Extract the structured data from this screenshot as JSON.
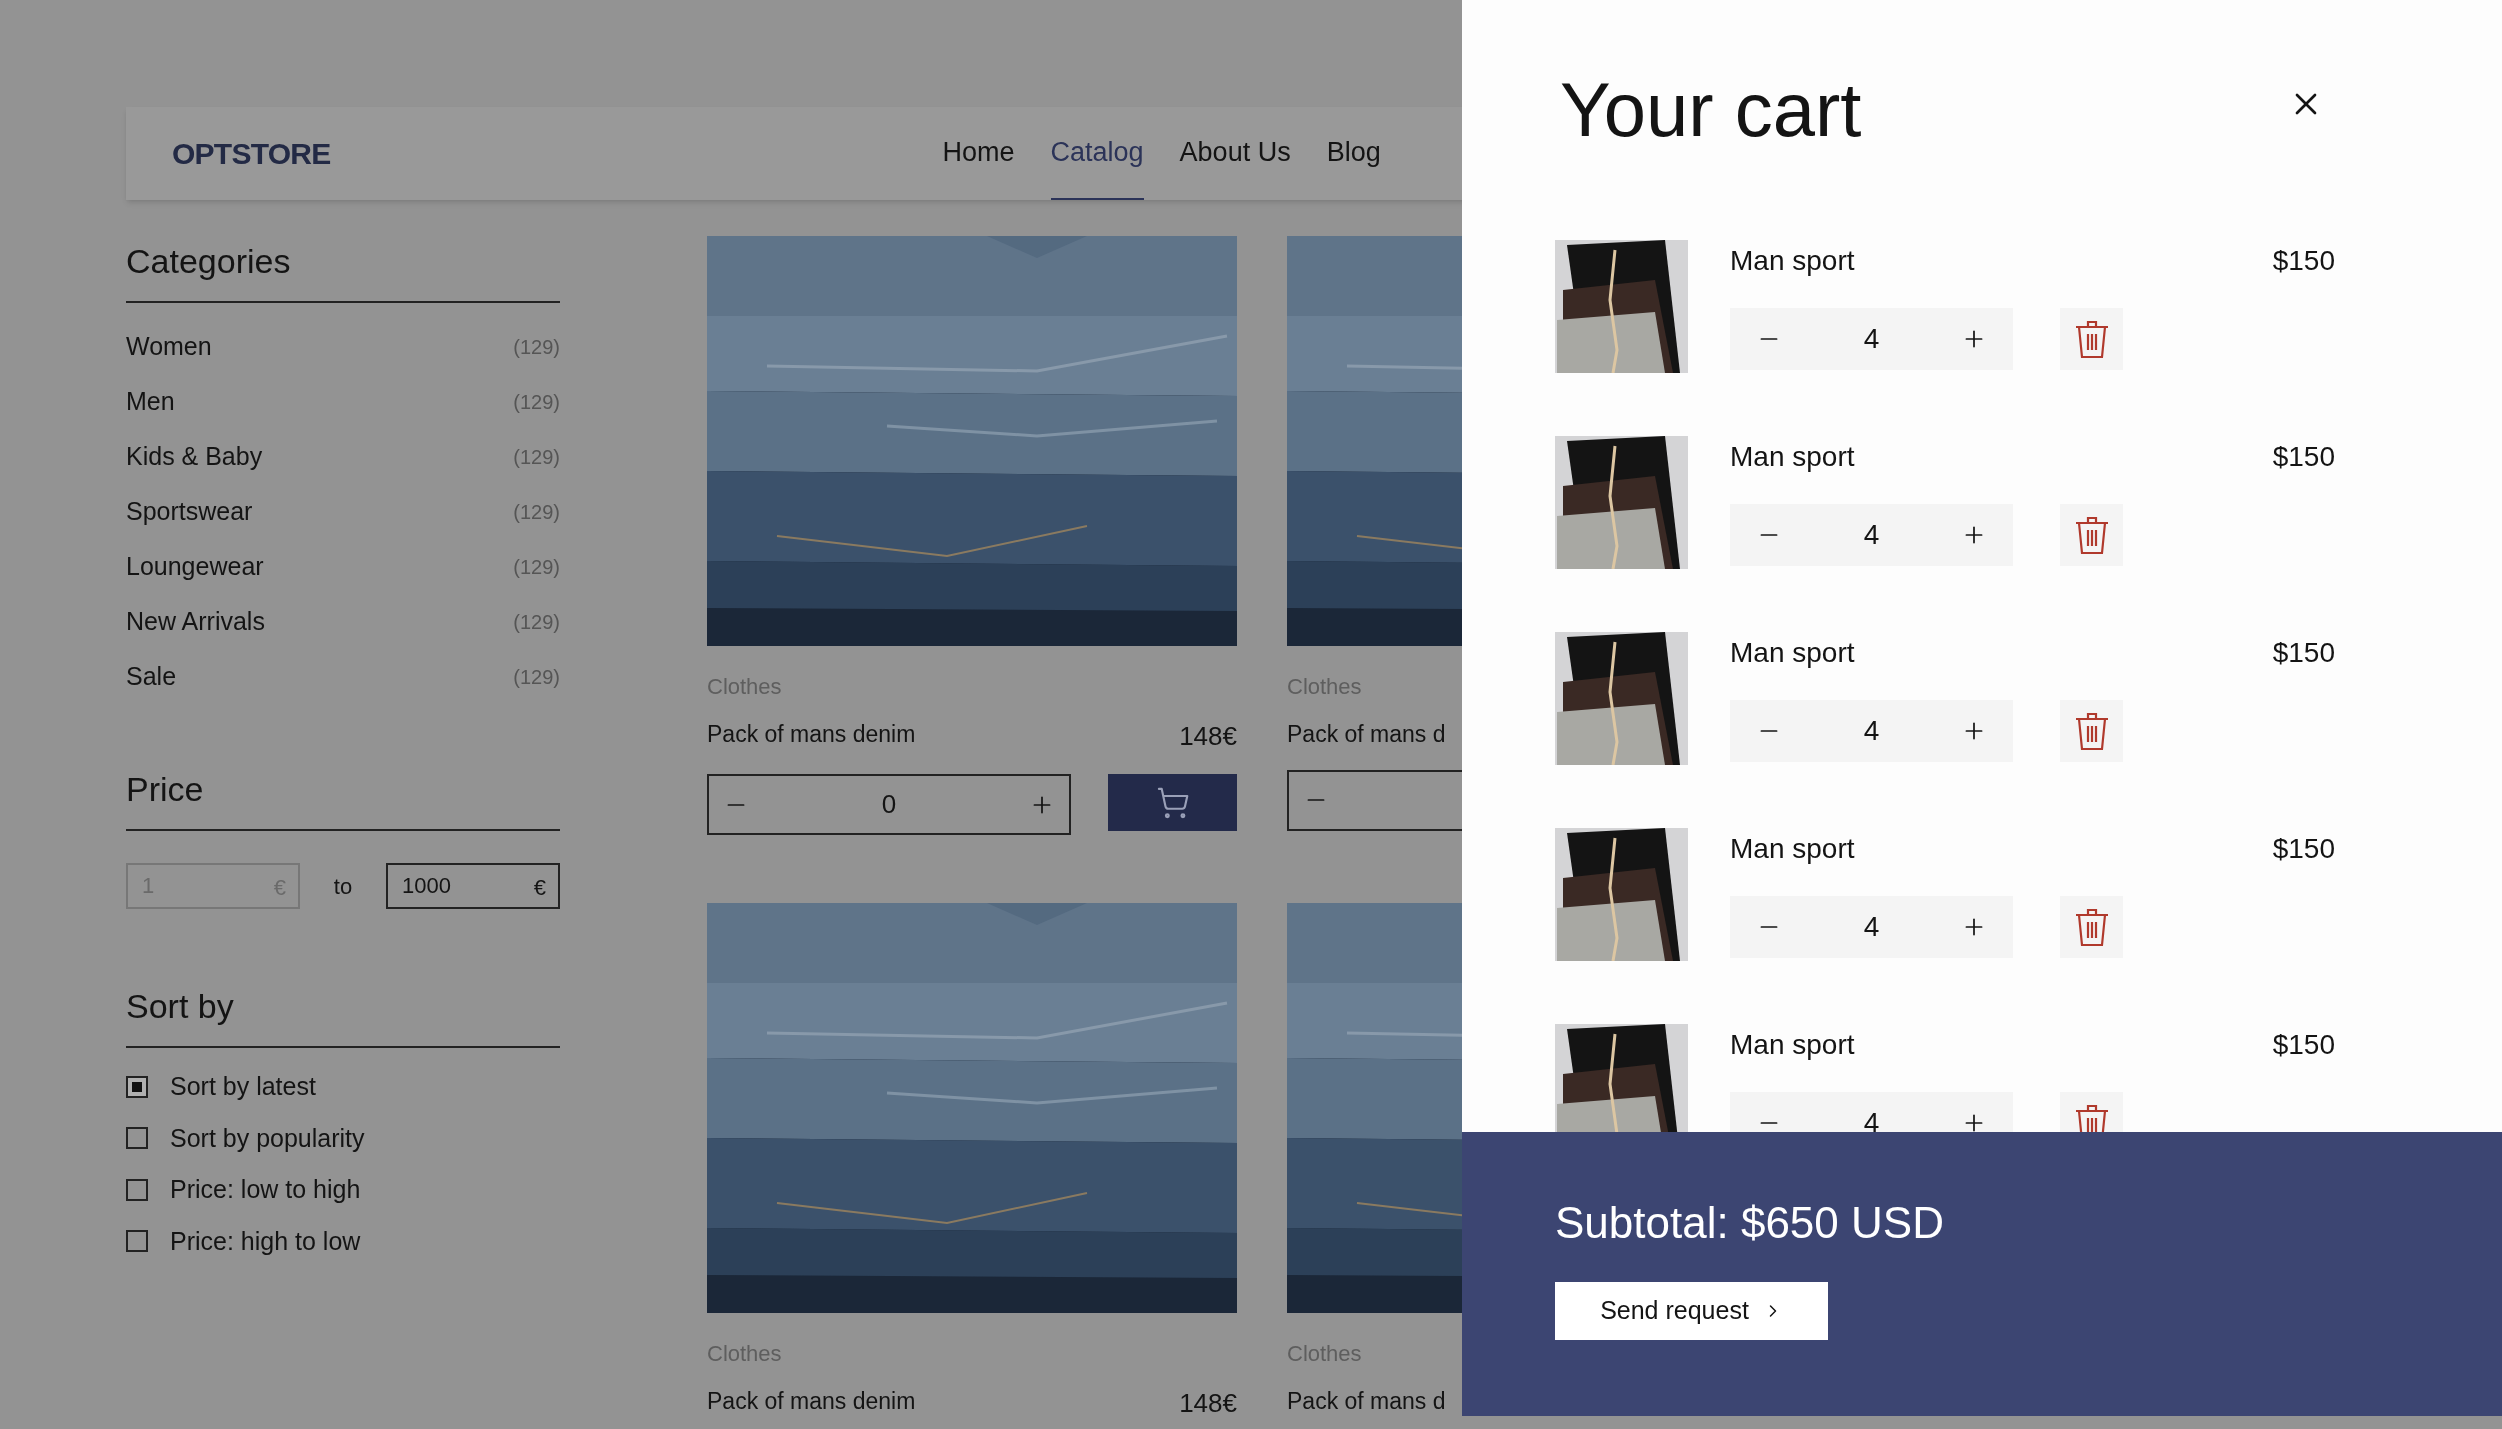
{
  "header": {
    "logo": "OPTSTORE",
    "nav": [
      {
        "label": "Home",
        "selected": false
      },
      {
        "label": "Catalog",
        "selected": true
      },
      {
        "label": "About Us",
        "selected": false
      },
      {
        "label": "Blog",
        "selected": false
      }
    ]
  },
  "sidebar": {
    "categories": {
      "title": "Categories",
      "items": [
        {
          "label": "Women",
          "count": "(129)"
        },
        {
          "label": "Men",
          "count": "(129)"
        },
        {
          "label": "Kids & Baby",
          "count": "(129)"
        },
        {
          "label": "Sportswear",
          "count": "(129)"
        },
        {
          "label": "Loungewear",
          "count": "(129)"
        },
        {
          "label": "New Arrivals",
          "count": "(129)"
        },
        {
          "label": "Sale",
          "count": "(129)"
        }
      ]
    },
    "price": {
      "title": "Price",
      "from": {
        "placeholder": "1",
        "currency": "€"
      },
      "separator": "to",
      "to": {
        "value": "1000",
        "currency": "€"
      }
    },
    "sort": {
      "title": "Sort by",
      "options": [
        {
          "label": "Sort by latest",
          "selected": true
        },
        {
          "label": "Sort by popularity",
          "selected": false
        },
        {
          "label": "Price: low to high",
          "selected": false
        },
        {
          "label": "Price: high to low",
          "selected": false
        }
      ]
    }
  },
  "products": [
    {
      "kind": "picture",
      "category": "Clothes",
      "name": "Pack of mans denim",
      "price": "148€",
      "stepper": true,
      "quantity": "0",
      "cart_button": true
    },
    {
      "kind": "picture",
      "category": "Clothes",
      "name": "Pack of mans d",
      "stepper": true
    },
    {
      "kind": "picture",
      "category": "Clothes",
      "name": "Pack of mans denim",
      "price": "148€"
    },
    {
      "kind": "picture",
      "category": "Clothes",
      "name": "Pack of mans d"
    }
  ],
  "cart": {
    "title": "Your cart",
    "items": [
      {
        "name": "Man sport",
        "price": "$150",
        "quantity": "4"
      },
      {
        "name": "Man sport",
        "price": "$150",
        "quantity": "4"
      },
      {
        "name": "Man sport",
        "price": "$150",
        "quantity": "4"
      },
      {
        "name": "Man sport",
        "price": "$150",
        "quantity": "4"
      },
      {
        "name": "Man sport",
        "price": "$150",
        "quantity": "4"
      }
    ],
    "subtotal": "Subtotal: $650 USD",
    "button": "Send request"
  }
}
